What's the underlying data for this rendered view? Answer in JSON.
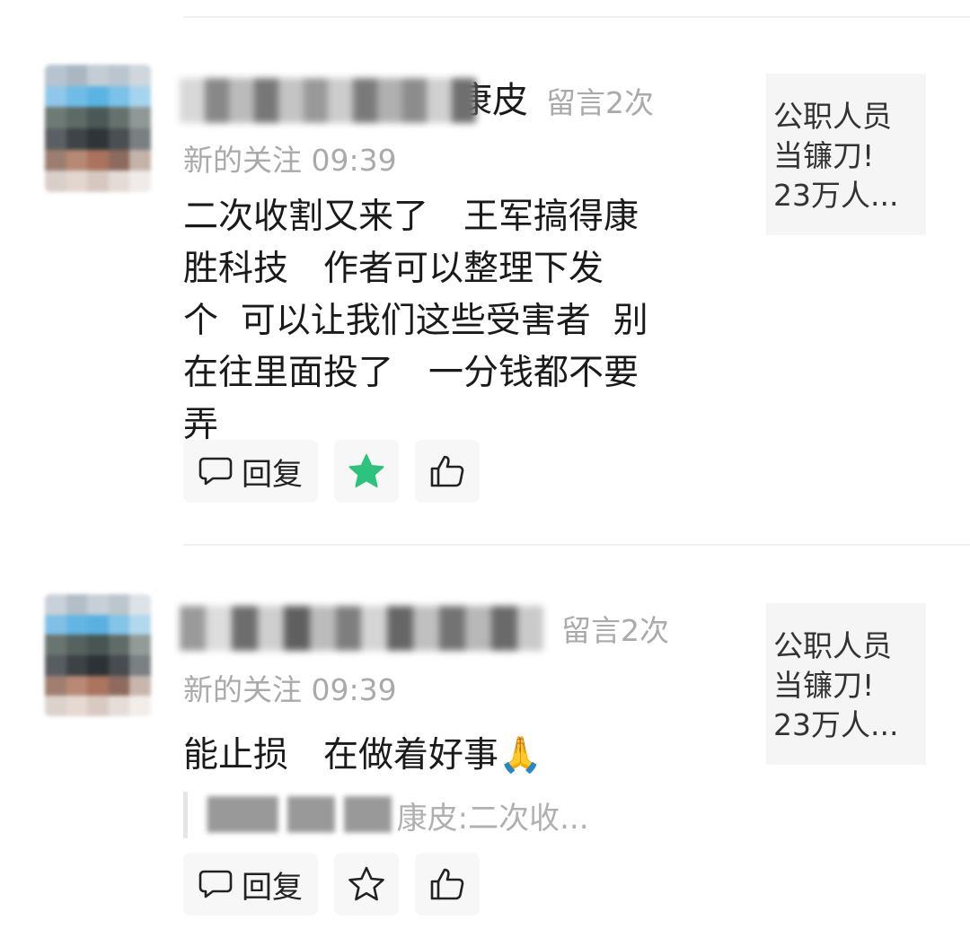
{
  "comments": [
    {
      "name_tail": "康皮",
      "msg_count": "留言2次",
      "meta": "新的关注 09:39",
      "body": "二次收割又来了　王军搞得康\n胜科技　作者可以整理下发\n个  可以让我们这些受害者  别\n在往里面投了　一分钱都不要\n弄",
      "reply_label": "回复",
      "star_filled": true,
      "article": [
        "公职人员",
        "当镰刀!",
        "23万人..."
      ]
    },
    {
      "name_tail": "",
      "msg_count": "留言2次",
      "meta": "新的关注 09:39",
      "body": "能止损　在做着好事🙏",
      "quote_tail": "康皮:二次收...",
      "reply_label": "回复",
      "star_filled": false,
      "article": [
        "公职人员",
        "当镰刀!",
        "23万人..."
      ]
    }
  ],
  "colors": {
    "star_green": "#2ec27e",
    "muted_gray": "#aaaaaa",
    "button_bg": "#f7f7f7"
  },
  "icons": [
    "comment-bubble-icon",
    "star-icon",
    "thumbs-up-icon"
  ]
}
